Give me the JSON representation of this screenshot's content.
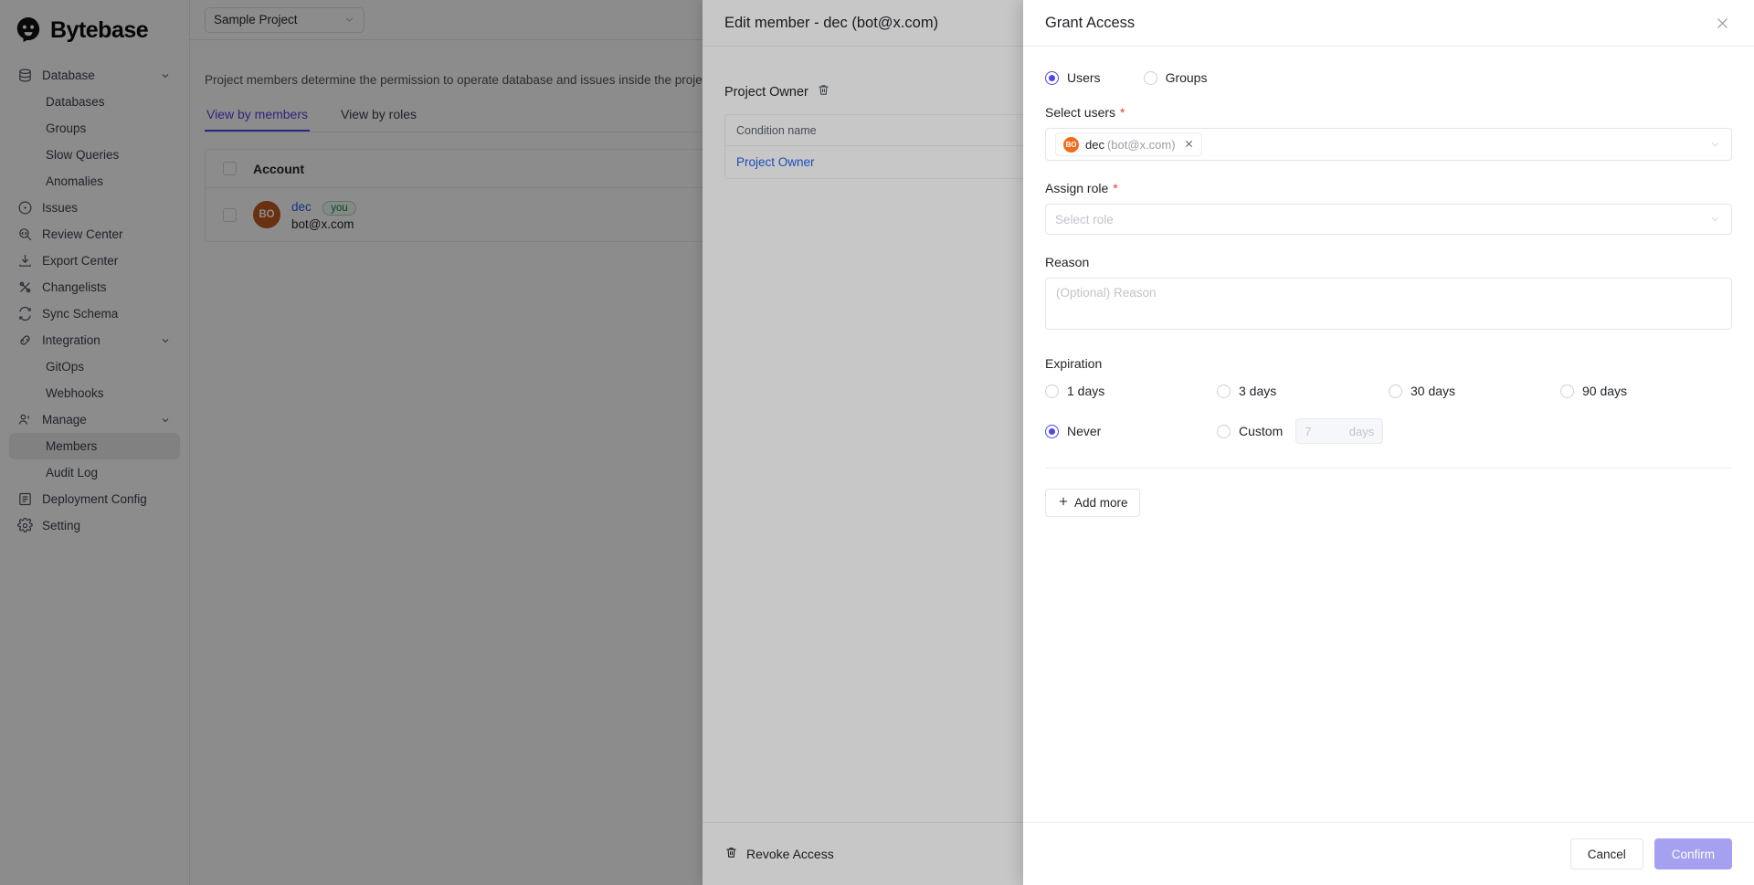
{
  "brand": {
    "name": "Bytebase",
    "logo_icon": "bytebase-logo-icon"
  },
  "sidebar": {
    "items": [
      {
        "label": "Database",
        "icon": "database-icon",
        "level": "top",
        "expandable": true,
        "active": false
      },
      {
        "label": "Databases",
        "icon": "",
        "level": "sub",
        "expandable": false,
        "active": false
      },
      {
        "label": "Groups",
        "icon": "",
        "level": "sub",
        "expandable": false,
        "active": false
      },
      {
        "label": "Slow Queries",
        "icon": "",
        "level": "sub",
        "expandable": false,
        "active": false
      },
      {
        "label": "Anomalies",
        "icon": "",
        "level": "sub",
        "expandable": false,
        "active": false
      },
      {
        "label": "Issues",
        "icon": "issues-icon",
        "level": "top",
        "expandable": false,
        "active": false
      },
      {
        "label": "Review Center",
        "icon": "review-center-icon",
        "level": "top",
        "expandable": false,
        "active": false
      },
      {
        "label": "Export Center",
        "icon": "export-center-icon",
        "level": "top",
        "expandable": false,
        "active": false
      },
      {
        "label": "Changelists",
        "icon": "changelists-icon",
        "level": "top",
        "expandable": false,
        "active": false
      },
      {
        "label": "Sync Schema",
        "icon": "sync-schema-icon",
        "level": "top",
        "expandable": false,
        "active": false
      },
      {
        "label": "Integration",
        "icon": "integration-icon",
        "level": "top",
        "expandable": true,
        "active": false
      },
      {
        "label": "GitOps",
        "icon": "",
        "level": "sub",
        "expandable": false,
        "active": false
      },
      {
        "label": "Webhooks",
        "icon": "",
        "level": "sub",
        "expandable": false,
        "active": false
      },
      {
        "label": "Manage",
        "icon": "manage-icon",
        "level": "top",
        "expandable": true,
        "active": false
      },
      {
        "label": "Members",
        "icon": "",
        "level": "sub",
        "expandable": false,
        "active": true
      },
      {
        "label": "Audit Log",
        "icon": "",
        "level": "sub",
        "expandable": false,
        "active": false
      },
      {
        "label": "Deployment Config",
        "icon": "deployment-config-icon",
        "level": "top",
        "expandable": false,
        "active": false
      },
      {
        "label": "Setting",
        "icon": "setting-icon",
        "level": "top",
        "expandable": false,
        "active": false
      }
    ]
  },
  "topbar": {
    "project_selector_value": "Sample Project"
  },
  "members_page": {
    "description": "Project members determine the permission to operate database and issues inside the project.",
    "tabs": [
      {
        "label": "View by members",
        "active": true
      },
      {
        "label": "View by roles",
        "active": false
      }
    ],
    "table": {
      "columns": [
        "Account"
      ],
      "rows": [
        {
          "avatar_initials": "BO",
          "name": "dec",
          "badge": "you",
          "email": "bot@x.com"
        }
      ]
    }
  },
  "edit_member_drawer": {
    "title": "Edit member - dec (bot@x.com)",
    "role_section": {
      "title": "Project Owner",
      "delete_icon": "trash-icon"
    },
    "condition_table": {
      "columns": [
        "Condition name"
      ],
      "rows": [
        "Project Owner"
      ]
    },
    "footer": {
      "revoke_label": "Revoke Access",
      "revoke_icon": "trash-icon"
    }
  },
  "grant_access_panel": {
    "title": "Grant Access",
    "close_icon": "close-icon",
    "target_type": {
      "options": [
        {
          "label": "Users",
          "selected": true
        },
        {
          "label": "Groups",
          "selected": false
        }
      ]
    },
    "select_users": {
      "label": "Select users",
      "required_marker": "*",
      "chips": [
        {
          "initials": "BO",
          "name": "dec",
          "email": "(bot@x.com)",
          "remove_icon": "close-icon"
        }
      ],
      "chevron_icon": "chevron-down-icon"
    },
    "assign_role": {
      "label": "Assign role",
      "required_marker": "*",
      "placeholder": "Select role",
      "value": "",
      "chevron_icon": "chevron-down-icon"
    },
    "reason": {
      "label": "Reason",
      "placeholder": "(Optional) Reason",
      "value": ""
    },
    "expiration": {
      "label": "Expiration",
      "options": [
        {
          "label": "1 days",
          "selected": false
        },
        {
          "label": "3 days",
          "selected": false
        },
        {
          "label": "30 days",
          "selected": false
        },
        {
          "label": "90 days",
          "selected": false
        },
        {
          "label": "Never",
          "selected": true
        },
        {
          "label": "Custom",
          "selected": false
        }
      ],
      "custom_days": {
        "placeholder": "7",
        "value": "",
        "suffix": "days"
      }
    },
    "add_more_label": "Add more",
    "add_more_icon": "plus-icon",
    "footer": {
      "cancel_label": "Cancel",
      "confirm_label": "Confirm",
      "confirm_disabled": true
    }
  },
  "colors": {
    "accent": "#4f46e5",
    "confirm_disabled": "#a5a0ef",
    "link": "#2563eb",
    "avatar_orange": "#c0591e",
    "chip_avatar_orange": "#ef6c1a",
    "badge_green": "#15803d",
    "required_red": "#e53935"
  }
}
